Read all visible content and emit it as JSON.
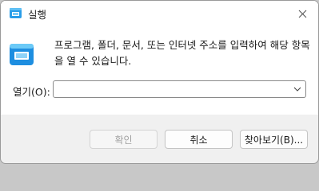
{
  "window": {
    "title": "실행",
    "close_icon": "close-icon"
  },
  "content": {
    "icon": "run-icon",
    "description": "프로그램, 폴더, 문서, 또는 인터넷 주소를 입력하여 해당 항목을 열 수 있습니다.",
    "open_label": "열기(O):",
    "open_value": "",
    "dropdown_icon": "chevron-down-icon"
  },
  "buttons": {
    "ok": "확인",
    "cancel": "취소",
    "browse": "찾아보기(B)..."
  },
  "colors": {
    "accent": "#1a8fe0",
    "titlebar": "#ffffff",
    "footer": "#f0f0f0"
  }
}
